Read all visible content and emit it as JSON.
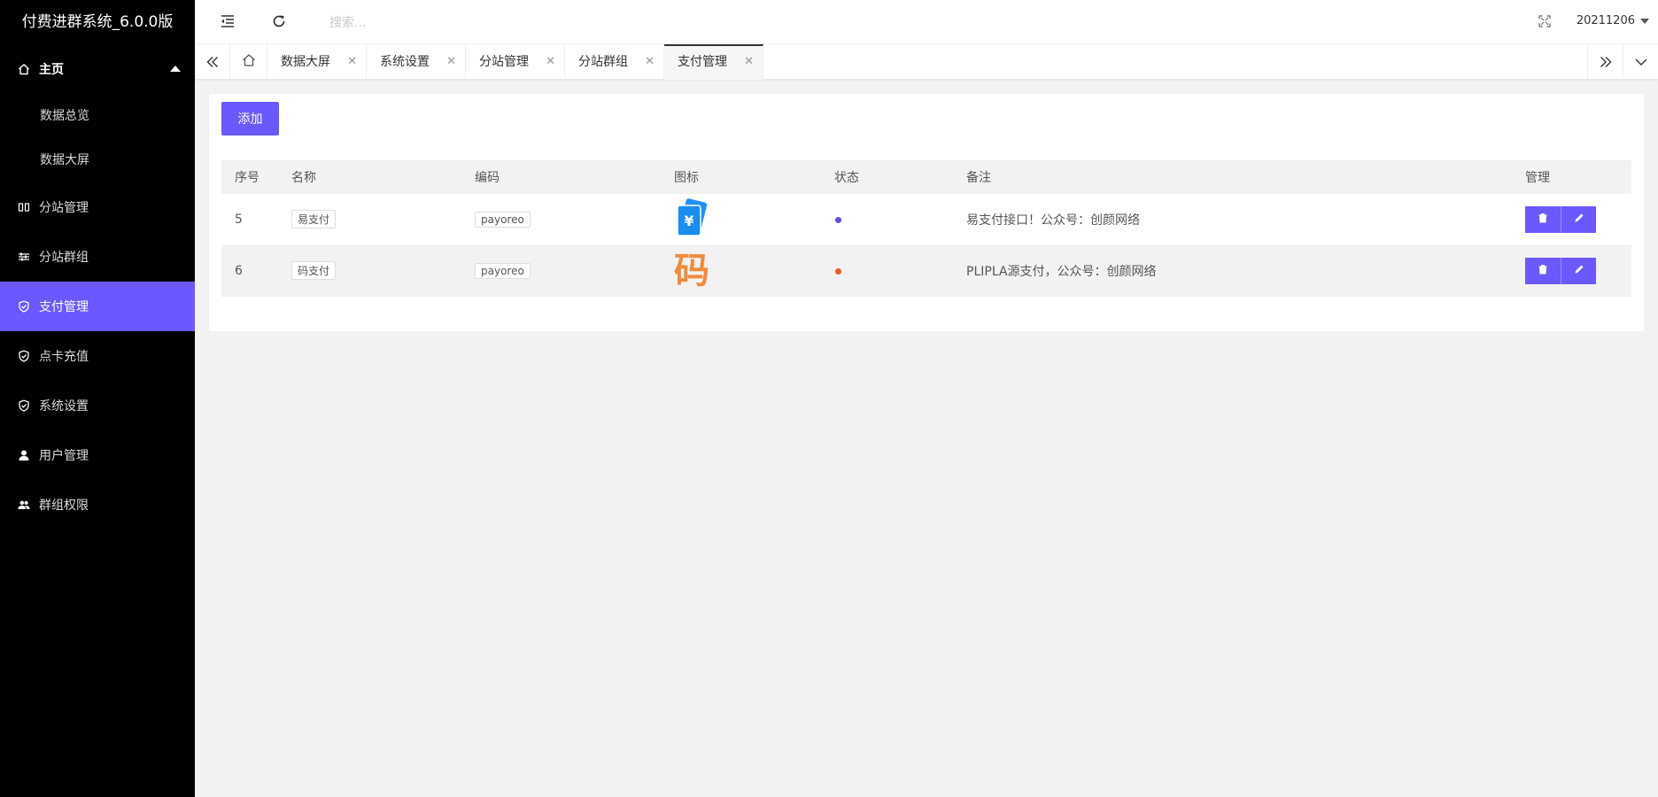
{
  "app": {
    "title": "付费进群系统_6.0.0版"
  },
  "sidebar": {
    "home_label": "主页",
    "home_icon": "home-icon",
    "sub_items": [
      {
        "label": "数据总览"
      },
      {
        "label": "数据大屏"
      }
    ],
    "items": [
      {
        "label": "分站管理",
        "icon": "columns-icon",
        "active": false
      },
      {
        "label": "分站群组",
        "icon": "sliders-icon",
        "active": false
      },
      {
        "label": "支付管理",
        "icon": "shield-check-icon",
        "active": true
      },
      {
        "label": "点卡充值",
        "icon": "shield-check-icon",
        "active": false
      },
      {
        "label": "系统设置",
        "icon": "shield-check-icon",
        "active": false
      },
      {
        "label": "用户管理",
        "icon": "user-icon",
        "active": false
      },
      {
        "label": "群组权限",
        "icon": "users-icon",
        "active": false
      }
    ],
    "active_color": "#6b58ff"
  },
  "header": {
    "search_placeholder": "搜索...",
    "username": "20211206"
  },
  "tabs": [
    {
      "label": "数据大屏",
      "active": false
    },
    {
      "label": "系统设置",
      "active": false
    },
    {
      "label": "分站管理",
      "active": false
    },
    {
      "label": "分站群组",
      "active": false
    },
    {
      "label": "支付管理",
      "active": true
    }
  ],
  "toolbar": {
    "add_label": "添加"
  },
  "table": {
    "columns": [
      "序号",
      "名称",
      "编码",
      "图标",
      "状态",
      "备注",
      "管理"
    ],
    "rows": [
      {
        "id": "5",
        "name": "易支付",
        "code": "payoreo",
        "icon": "yuan-card-icon",
        "status_color": "#5b4ee8",
        "remark": "易支付接口！公众号：创颜网络"
      },
      {
        "id": "6",
        "name": "码支付",
        "code": "payoreo",
        "icon_text": "码",
        "status_color": "#f05a22",
        "remark": "PLIPLA源支付，公众号：创颜网络"
      }
    ]
  }
}
